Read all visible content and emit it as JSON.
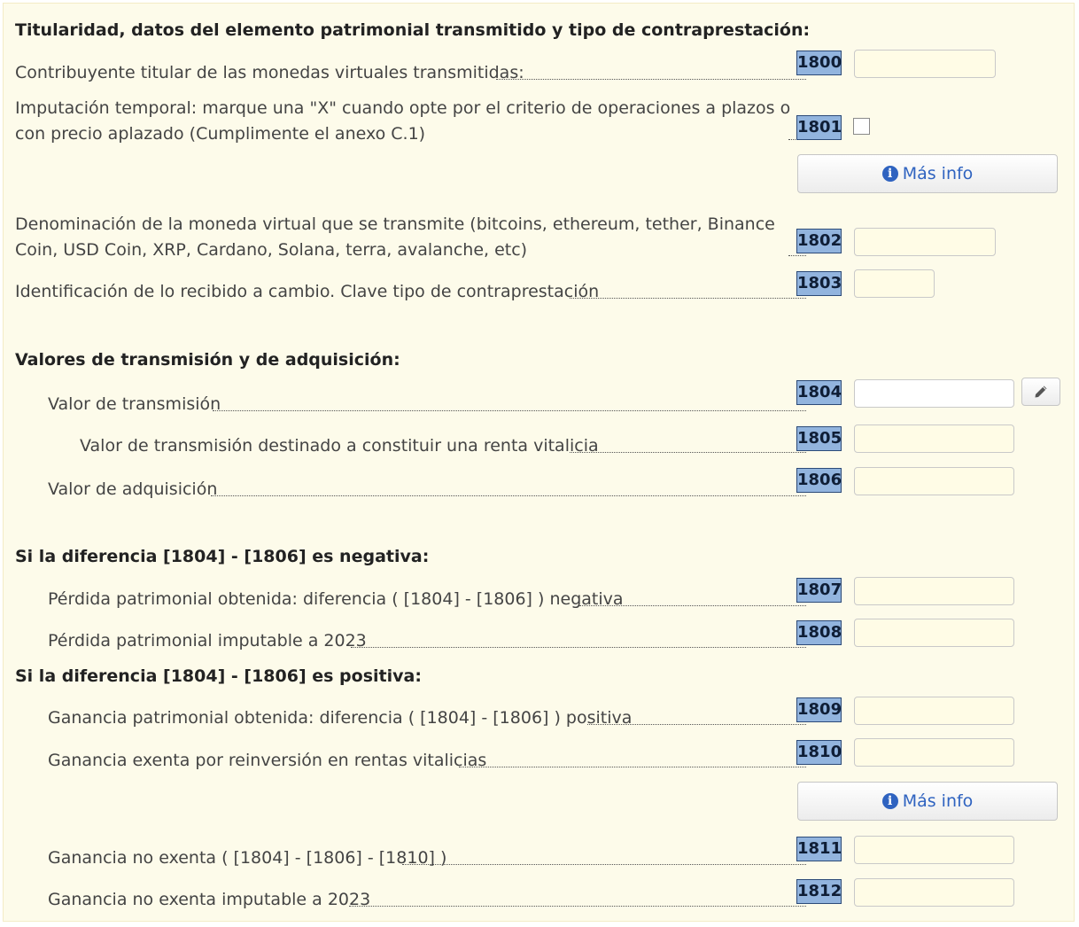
{
  "sections": {
    "titularidad": "Titularidad, datos del elemento patrimonial transmitido y tipo de contraprestación:",
    "valores": "Valores de transmisión y de adquisición:",
    "negativa": "Si la diferencia [1804] - [1806] es negativa:",
    "positiva": "Si la diferencia [1804] - [1806] es positiva:"
  },
  "rows": {
    "r1800": {
      "code": "1800",
      "label": "Contribuyente titular de las monedas virtuales transmitidas:",
      "value": ""
    },
    "r1801": {
      "code": "1801",
      "label": "Imputación temporal: marque una \"X\" cuando opte por el criterio de operaciones a plazos o con precio aplazado (Cumplimente el anexo C.1)",
      "checked": false
    },
    "r1802": {
      "code": "1802",
      "label": "Denominación de la moneda virtual que se transmite (bitcoins, ethereum, tether, Binance Coin, USD Coin, XRP, Cardano, Solana, terra, avalanche, etc)",
      "value": ""
    },
    "r1803": {
      "code": "1803",
      "label": "Identificación de lo recibido a cambio. Clave tipo de contraprestación",
      "value": ""
    },
    "r1804": {
      "code": "1804",
      "label": "Valor de transmisión",
      "value": ""
    },
    "r1805": {
      "code": "1805",
      "label": "Valor de transmisión destinado a constituir una renta vitalicia",
      "value": ""
    },
    "r1806": {
      "code": "1806",
      "label": "Valor de adquisición",
      "value": ""
    },
    "r1807": {
      "code": "1807",
      "label": "Pérdida patrimonial obtenida: diferencia ( [1804] - [1806] ) negativa",
      "value": ""
    },
    "r1808": {
      "code": "1808",
      "label": "Pérdida patrimonial imputable a 2023",
      "value": ""
    },
    "r1809": {
      "code": "1809",
      "label": "Ganancia patrimonial obtenida: diferencia ( [1804] - [1806] ) positiva",
      "value": ""
    },
    "r1810": {
      "code": "1810",
      "label": "Ganancia exenta por reinversión en rentas vitalicias",
      "value": ""
    },
    "r1811": {
      "code": "1811",
      "label": "Ganancia no exenta ( [1804] - [1806] - [1810] )",
      "value": ""
    },
    "r1812": {
      "code": "1812",
      "label": "Ganancia no exenta imputable a 2023",
      "value": ""
    }
  },
  "buttons": {
    "mas_info": "Más info",
    "info_glyph": "i"
  },
  "icons": {
    "info": "info-circle-icon",
    "edit": "pencil-icon"
  },
  "colors": {
    "panel_bg": "#fdfbea",
    "code_box": "#92b4de",
    "field_bg": "#fffce6",
    "link": "#2f63c0"
  }
}
